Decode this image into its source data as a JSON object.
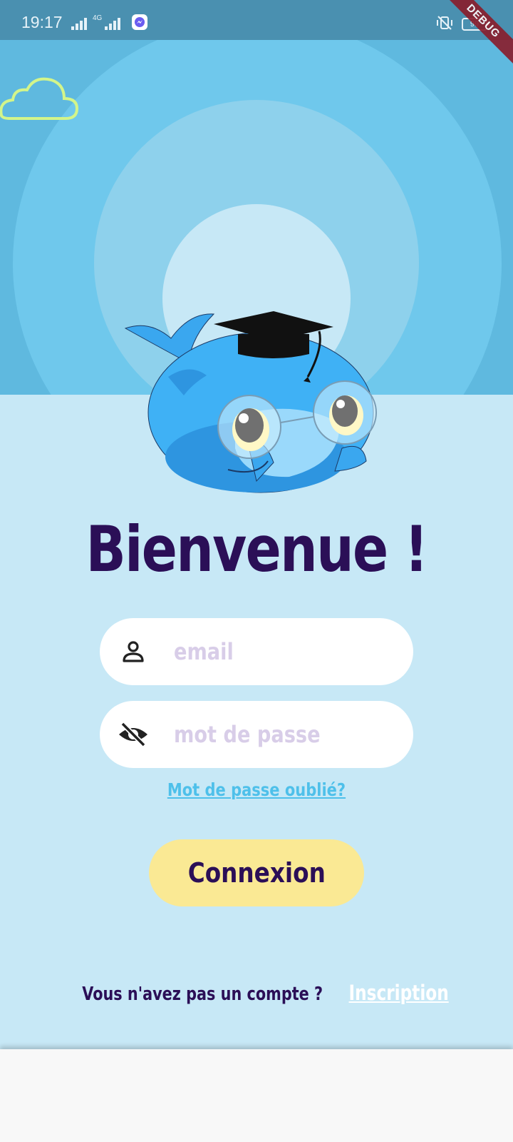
{
  "status_bar": {
    "time": "19:17",
    "network_label": "4G",
    "battery_level": "99"
  },
  "debug_banner": "DEBUG",
  "welcome": {
    "title": "Bienvenue !"
  },
  "login_form": {
    "email_placeholder": "email",
    "password_placeholder": "mot de passe",
    "forgot_password_label": "Mot de passe oublié?",
    "login_button_label": "Connexion"
  },
  "signup": {
    "question": "Vous n'avez pas un compte ?",
    "link_label": "Inscription"
  },
  "icons": {
    "user": "user-icon",
    "password_visibility": "eye-off-icon",
    "mascot": "dolphin-mascot",
    "cloud": "cloud-icon"
  },
  "colors": {
    "header_blue": "#5fb9df",
    "background_light_blue": "#c7e8f6",
    "title_purple": "#2b0f57",
    "button_yellow": "#fae994",
    "link_blue": "#4ec0ea",
    "placeholder_lavender": "#d8cde8"
  }
}
